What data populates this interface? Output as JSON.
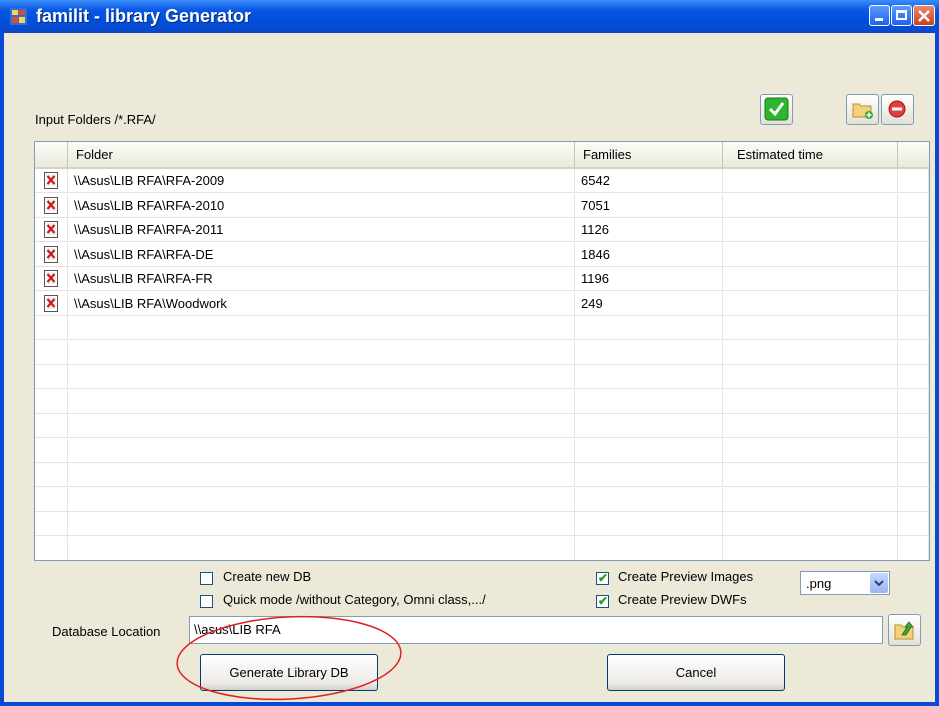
{
  "window": {
    "title": "familit - library Generator"
  },
  "input_folders_label": "Input Folders /*.RFA/",
  "toolbar": {
    "confirm_icon": "green-check-icon",
    "add_folder_icon": "add-folder-icon",
    "remove_icon": "remove-icon"
  },
  "grid": {
    "columns": [
      "Folder",
      "Families",
      "Estimated time"
    ],
    "rows": [
      {
        "folder": "\\\\Asus\\LIB RFA\\RFA-2009",
        "families": "6542",
        "time": ""
      },
      {
        "folder": "\\\\Asus\\LIB RFA\\RFA-2010",
        "families": "7051",
        "time": ""
      },
      {
        "folder": "\\\\Asus\\LIB RFA\\RFA-2011",
        "families": "1126",
        "time": ""
      },
      {
        "folder": "\\\\Asus\\LIB RFA\\RFA-DE",
        "families": "1846",
        "time": ""
      },
      {
        "folder": "\\\\Asus\\LIB RFA\\RFA-FR",
        "families": "1196",
        "time": ""
      },
      {
        "folder": "\\\\Asus\\LIB RFA\\Woodwork",
        "families": "249",
        "time": ""
      }
    ]
  },
  "options": {
    "create_new_db": {
      "label": "Create new DB",
      "checked": false
    },
    "quick_mode": {
      "label": "Quick mode /without Category, Omni class,.../",
      "checked": false
    },
    "create_preview_images": {
      "label": "Create Preview Images",
      "checked": true
    },
    "create_preview_dwfs": {
      "label": "Create Preview DWFs",
      "checked": true
    },
    "image_format": ".png"
  },
  "database": {
    "label": "Database Location",
    "value": "\\\\asus\\LIB RFA"
  },
  "buttons": {
    "generate": "Generate Library DB",
    "cancel": "Cancel"
  },
  "colors": {
    "title_bar": "#0a58e4",
    "annotation_circle": "#e02020",
    "window_bg": "#ece9d8"
  }
}
